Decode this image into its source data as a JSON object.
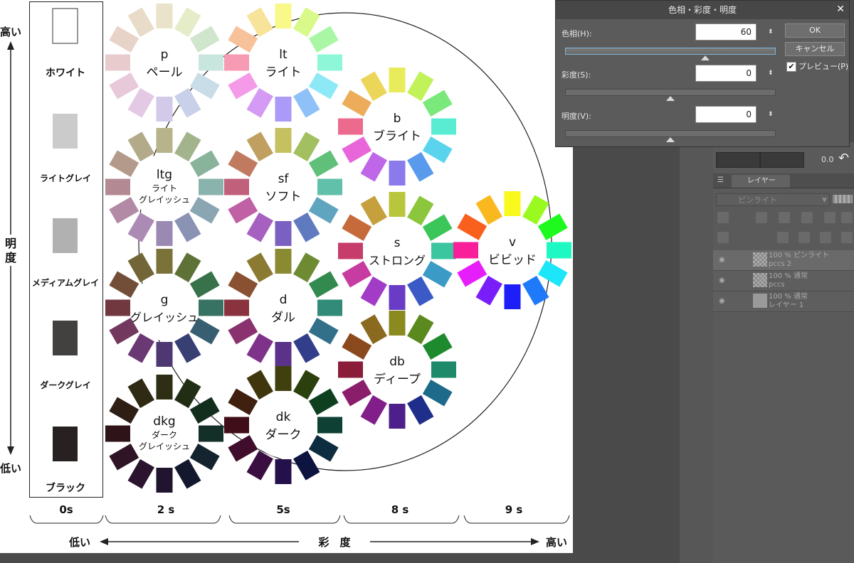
{
  "canvas": {
    "value_axis": {
      "high": "高い",
      "low": "低い",
      "title": [
        "明",
        "度"
      ]
    },
    "saturation_axis": {
      "low": "低い",
      "title": "彩　度",
      "high": "高い"
    },
    "column_labels": [
      "0s",
      "2 s",
      "5s",
      "8 s",
      "9 s"
    ],
    "greys": [
      {
        "label": "ホワイト",
        "color": "#ffffff"
      },
      {
        "label": "ライトグレイ",
        "color": "#cbcbcb"
      },
      {
        "label": "メディアムグレイ",
        "color": "#b1b1b1"
      },
      {
        "label": "ダークグレイ",
        "color": "#434040"
      },
      {
        "label": "ブラック",
        "color": "#272121"
      }
    ],
    "tones": [
      {
        "abbr": "p",
        "name": [
          "ペール"
        ],
        "colors": [
          "#e8e3c9",
          "#e4ecc8",
          "#cfe6cc",
          "#c9e6de",
          "#c8dde8",
          "#c9d0ea",
          "#d3c9e8",
          "#e4c9e4",
          "#e8c9d9",
          "#e8cbcc",
          "#e8d3c9",
          "#e8dcc9"
        ]
      },
      {
        "abbr": "lt",
        "name": [
          "ライト"
        ],
        "colors": [
          "#f9f98a",
          "#d9f98a",
          "#a9f7a4",
          "#8ef7d7",
          "#8ee9f7",
          "#8ec1f7",
          "#ab9af7",
          "#d49af4",
          "#f49ae8",
          "#f79ab4",
          "#f7c19a",
          "#f7e39a"
        ]
      },
      {
        "abbr": "b",
        "name": [
          "ブライト"
        ],
        "colors": [
          "#e8ec5a",
          "#c1f25a",
          "#7ae87a",
          "#5aecd3",
          "#5ad4ec",
          "#5a9aec",
          "#8a7aec",
          "#c066e8",
          "#e866d9",
          "#ec6a8e",
          "#ecac5a",
          "#ecd65a"
        ]
      },
      {
        "abbr": "ltg",
        "name": [
          "ライト",
          "グレイッシュ"
        ],
        "colors": [
          "#b7b48b",
          "#a3b38b",
          "#8ab39b",
          "#8ab3ad",
          "#8aa6b3",
          "#8a93b3",
          "#9a8ab3",
          "#ab8ab3",
          "#b38aa6",
          "#b38a93",
          "#b39a8a",
          "#b3aa8a"
        ]
      },
      {
        "abbr": "sf",
        "name": [
          "ソフト"
        ],
        "colors": [
          "#c5c060",
          "#a2c060",
          "#60c07a",
          "#60c0aa",
          "#60a5c0",
          "#607ac0",
          "#7a60c0",
          "#a560c0",
          "#c060a5",
          "#c0607a",
          "#c07a60",
          "#c0a060"
        ]
      },
      {
        "abbr": "s",
        "name": [
          "ストロング"
        ],
        "colors": [
          "#b8c63c",
          "#8cc63c",
          "#3cc65a",
          "#3cc6a0",
          "#3c9ac6",
          "#3c5ac6",
          "#6a3cc6",
          "#a23cc6",
          "#c63ca0",
          "#c63c6a",
          "#c66a3c",
          "#c6a03c"
        ]
      },
      {
        "abbr": "v",
        "name": [
          "ビビッド"
        ],
        "colors": [
          "#f9f91e",
          "#9af91e",
          "#1ef91e",
          "#1ef9c4",
          "#1ee6f9",
          "#1e7af9",
          "#1e1ef9",
          "#7a1ef9",
          "#e61ef9",
          "#f91e9a",
          "#f9601e",
          "#f9b81e"
        ]
      },
      {
        "abbr": "g",
        "name": [
          "グレイッシュ"
        ],
        "colors": [
          "#7a7238",
          "#5e7238",
          "#38724a",
          "#387262",
          "#385e72",
          "#383f72",
          "#4e3872",
          "#6a3872",
          "#72385e",
          "#72383f",
          "#724e38",
          "#726638"
        ]
      },
      {
        "abbr": "d",
        "name": [
          "ダル"
        ],
        "colors": [
          "#8a8a32",
          "#6e8a32",
          "#328a4e",
          "#328a78",
          "#32708a",
          "#323e8a",
          "#5a328a",
          "#7e328a",
          "#8a3270",
          "#8a323e",
          "#8a5032",
          "#8a7a32"
        ]
      },
      {
        "abbr": "db",
        "name": [
          "ディープ"
        ],
        "colors": [
          "#8a8a1e",
          "#5a8a1e",
          "#1e8a2e",
          "#1e8a6a",
          "#1e6a8a",
          "#1e2e8a",
          "#4e1e8a",
          "#821e8a",
          "#8a1e6a",
          "#8a1e3a",
          "#8a4a1e",
          "#8a6a1e"
        ]
      },
      {
        "abbr": "dkg",
        "name": [
          "ダーク",
          "グレイッシュ"
        ],
        "colors": [
          "#2e2e14",
          "#222e14",
          "#142e1e",
          "#142e28",
          "#14242e",
          "#14182e",
          "#20142e",
          "#2a142e",
          "#2e1424",
          "#2e1418",
          "#2e1e14",
          "#2e2a14"
        ]
      },
      {
        "abbr": "dk",
        "name": [
          "ダーク"
        ],
        "colors": [
          "#40400e",
          "#2c400e",
          "#0e4020",
          "#0e4034",
          "#0e2c40",
          "#0e1440",
          "#24104a",
          "#3a0e40",
          "#400e2c",
          "#400e18",
          "#40200e",
          "#40360e"
        ]
      }
    ]
  },
  "dialog": {
    "title": "色相・彩度・明度",
    "close": "✕",
    "hue_label": "色相(H):",
    "hue_value": "60",
    "sat_label": "彩度(S):",
    "sat_value": "0",
    "val_label": "明度(V):",
    "val_value": "0",
    "spin": "⬍",
    "ok": "OK",
    "cancel": "キャンセル",
    "preview_check": "✔",
    "preview": "プレビュー(P)"
  },
  "panel": {
    "zoom": "0.0",
    "undo": "↶",
    "tab_icon": "☰",
    "layer_tab": "レイヤー",
    "blend_mode": "ピンライト",
    "blend_arrow": "▼",
    "eye": "◉",
    "layers": [
      {
        "line1": "100 % ピンライト",
        "line2": "pccs 2",
        "selected": true
      },
      {
        "line1": "100 % 通常",
        "line2": "pccs",
        "selected": false
      },
      {
        "line1": "100 % 通常",
        "line2": "レイヤー 1",
        "selected": false
      }
    ]
  }
}
